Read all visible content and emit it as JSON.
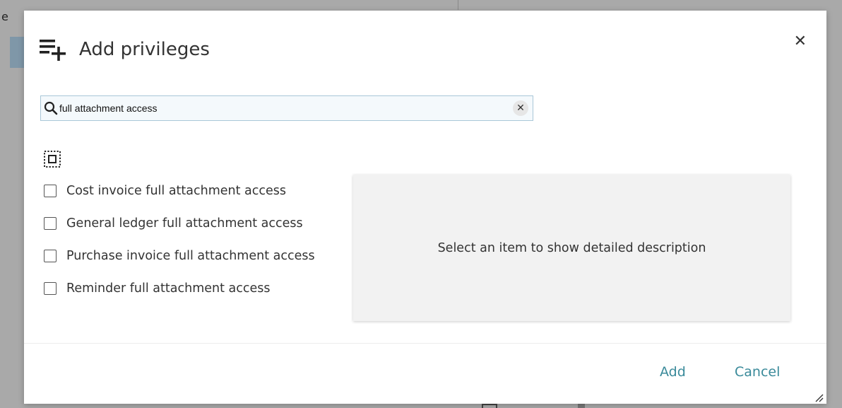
{
  "background": {
    "left_letter": "e"
  },
  "dialog": {
    "title": "Add privileges",
    "title_icon": "playlist-add-icon",
    "close_label": "✕",
    "search": {
      "value": "full attachment access",
      "icon": "search-icon",
      "clear_label": "✕"
    },
    "select_all_icon": "select-all-icon",
    "privileges": [
      {
        "label": "Cost invoice full attachment access",
        "checked": false
      },
      {
        "label": "General ledger full attachment access",
        "checked": false
      },
      {
        "label": "Purchase invoice full attachment access",
        "checked": false
      },
      {
        "label": "Reminder full attachment access",
        "checked": false
      }
    ],
    "description_placeholder": "Select an item to show detailed description",
    "footer": {
      "add_label": "Add",
      "cancel_label": "Cancel"
    }
  },
  "colors": {
    "accent": "#3a8a9a",
    "search_border": "#a9c7d8",
    "panel_bg": "#f2f2f2",
    "overlay": "#a9a9a9"
  }
}
